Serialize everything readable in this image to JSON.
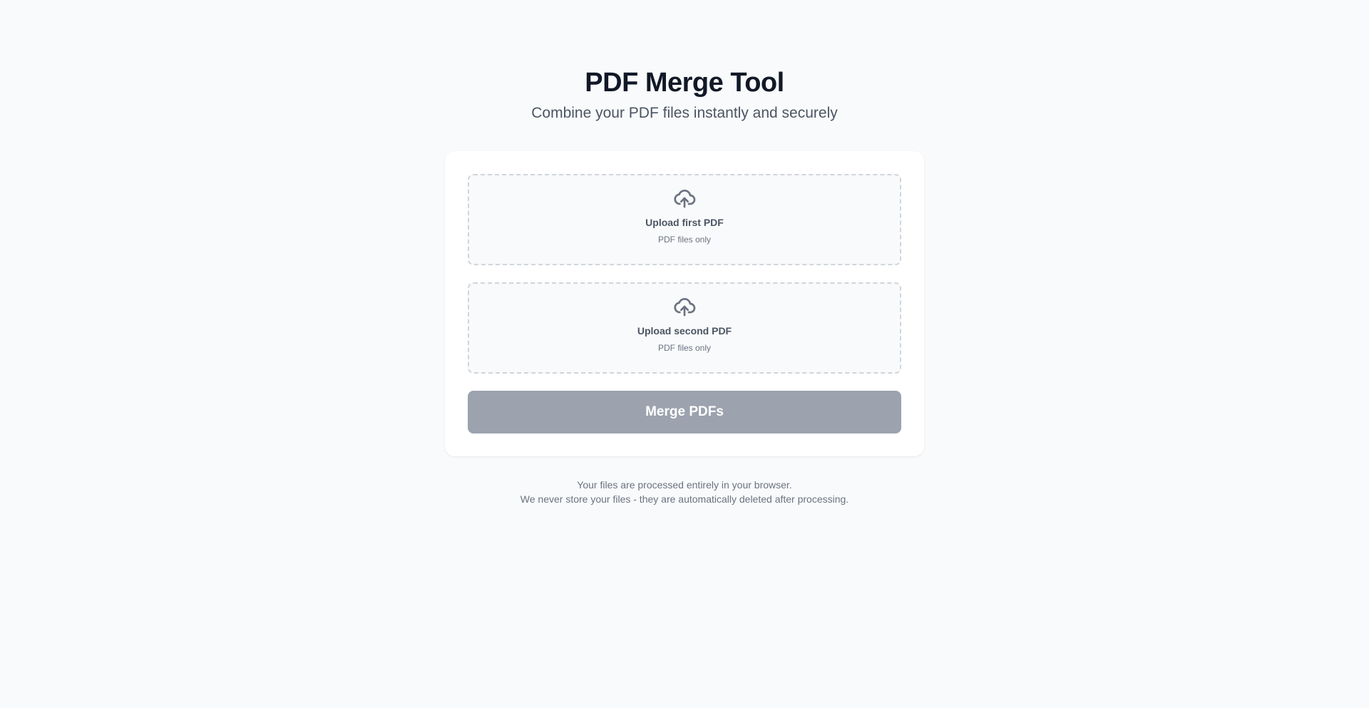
{
  "header": {
    "title": "PDF Merge Tool",
    "subtitle": "Combine your PDF files instantly and securely"
  },
  "uploads": [
    {
      "label": "Upload first PDF",
      "hint": "PDF files only",
      "icon": "cloud-upload-icon"
    },
    {
      "label": "Upload second PDF",
      "hint": "PDF files only",
      "icon": "cloud-upload-icon"
    }
  ],
  "merge_button": {
    "label": "Merge PDFs",
    "state": "disabled"
  },
  "footer": {
    "line1": "Your files are processed entirely in your browser.",
    "line2": "We never store your files - they are automatically deleted after processing."
  },
  "colors": {
    "background": "#f9fafb",
    "card": "#ffffff",
    "title": "#111827",
    "subtitle": "#4b5563",
    "dropzone_border": "#d1d5db",
    "icon": "#6b7280",
    "button_disabled": "#9ca3af",
    "button_text": "#ffffff"
  }
}
